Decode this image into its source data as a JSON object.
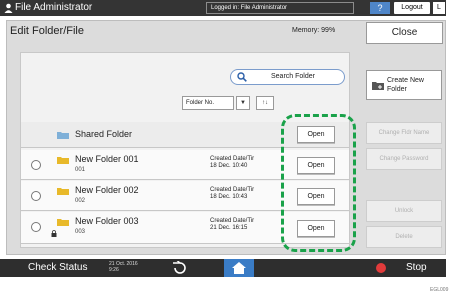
{
  "topbar": {
    "title": "File Administrator",
    "login_status": "Logged in: File Administrator",
    "help_label": "?",
    "logout_label": "Logout",
    "extra_label": "L"
  },
  "panel": {
    "title": "Edit Folder/File",
    "memory": "Memory: 99%",
    "close_label": "Close"
  },
  "search": {
    "label": "Search Folder",
    "icon": "search-icon"
  },
  "sort": {
    "selected": "Folder No.",
    "dropdown_icon": "▼",
    "order_icon": "↑↓"
  },
  "shared_folder": {
    "name": "Shared Folder",
    "open_label": "Open"
  },
  "folders": [
    {
      "name": "New Folder 001",
      "number": "001",
      "meta_line1": "Created Date/Tir",
      "meta_line2": "18 Dec. 10:40",
      "open_label": "Open",
      "locked": false
    },
    {
      "name": "New Folder 002",
      "number": "002",
      "meta_line1": "Created Date/Tir",
      "meta_line2": "18 Dec. 10:43",
      "open_label": "Open",
      "locked": false
    },
    {
      "name": "New Folder 003",
      "number": "003",
      "meta_line1": "Created Date/Tir",
      "meta_line2": "21 Dec. 16:15",
      "open_label": "Open",
      "locked": true
    }
  ],
  "side_buttons": {
    "create_label": "Create New Folder",
    "change_name": "Change Fldr Name",
    "change_password": "Change Password",
    "unlock": "Unlock",
    "delete": "Delete"
  },
  "bottombar": {
    "check_status": "Check Status",
    "clock_line1": "21 Oct. 2016",
    "clock_line2": "9:26",
    "stop_label": "Stop"
  },
  "figure_id": "EGL009",
  "colors": {
    "highlight": "#1aa24a",
    "folder": "#e8b92a",
    "home": "#3a7cc6",
    "stop": "#e23b3b",
    "topbar": "#343434"
  }
}
